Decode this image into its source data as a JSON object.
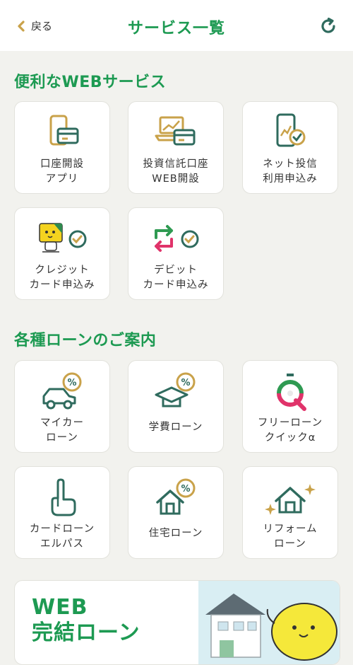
{
  "header": {
    "back_label": "戻る",
    "title": "サービス一覧"
  },
  "sections": [
    {
      "title": "便利なWEBサービス",
      "items": [
        {
          "label": "口座開設\nアプリ",
          "icon": "phone-card-icon"
        },
        {
          "label": "投資信託口座\nWEB開設",
          "icon": "laptop-card-icon"
        },
        {
          "label": "ネット投信\n利用申込み",
          "icon": "phone-chart-check-icon"
        },
        {
          "label": "クレジット\nカード申込み",
          "icon": "mascot-card-check-icon"
        },
        {
          "label": "デビット\nカード申込み",
          "icon": "debit-swap-check-icon"
        }
      ]
    },
    {
      "title": "各種ローンのご案内",
      "items": [
        {
          "label": "マイカー\nローン",
          "icon": "car-percent-icon"
        },
        {
          "label": "学費ローン",
          "icon": "graduation-cap-percent-icon"
        },
        {
          "label": "フリーローン\nクイックα",
          "icon": "quick-q-icon"
        },
        {
          "label": "カードローン\nエルパス",
          "icon": "hand-gesture-icon"
        },
        {
          "label": "住宅ローン",
          "icon": "house-percent-icon"
        },
        {
          "label": "リフォーム\nローン",
          "icon": "house-sparkle-icon"
        }
      ]
    }
  ],
  "banner": {
    "text": "WEB\n完結ローン"
  },
  "colors": {
    "brand_green": "#1d9a52",
    "icon_teal": "#2f6b5e",
    "icon_gold": "#c9a24a",
    "background": "#f2f2ee"
  }
}
